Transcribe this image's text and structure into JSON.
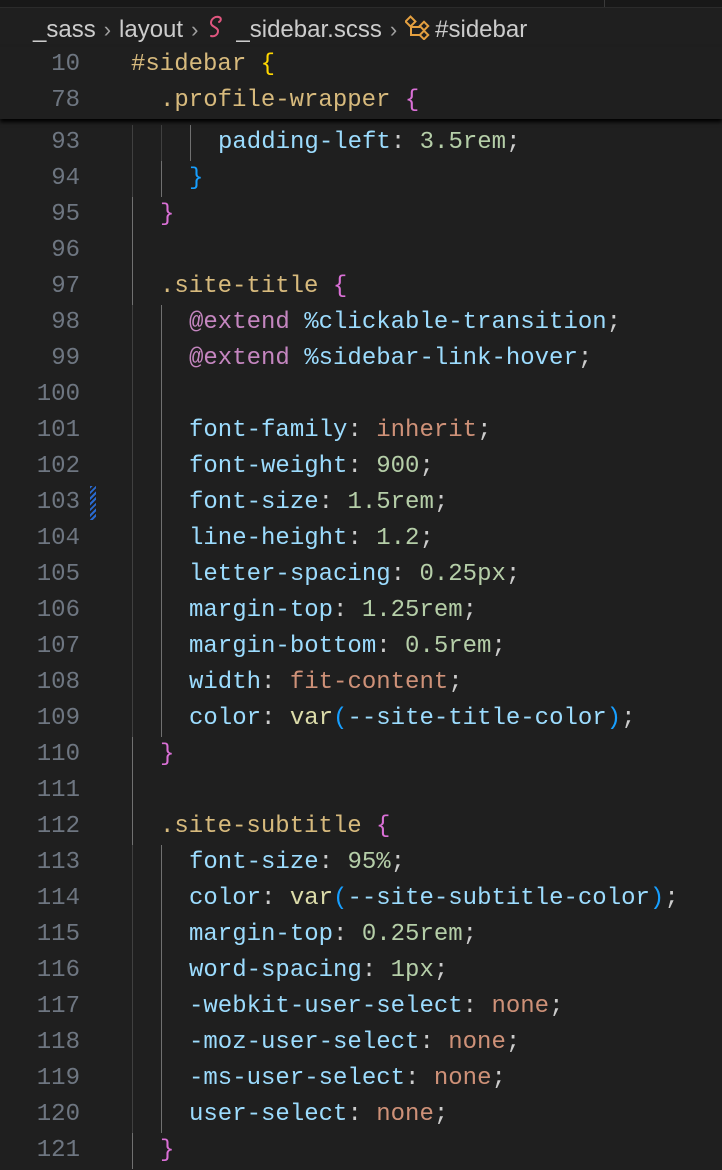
{
  "palette": {
    "sel": "#d7ba7d",
    "prop": "#9cdcfe",
    "num": "#b5cea8",
    "str": "#ce9178",
    "fn": "#dcdcaa",
    "at": "#c586c0",
    "punc": "#cccccc",
    "b1": "#ffd700",
    "b2": "#da70d6",
    "b3": "#179fff"
  },
  "breadcrumb": {
    "items": [
      "_sass",
      "layout",
      "_sidebar.scss",
      "#sidebar"
    ],
    "file_icon": "sass-icon",
    "file_icon_color": "#e0567f",
    "symbol_icon": "symbol-structure-icon",
    "symbol_icon_color": "#e4a040",
    "separator": "›"
  },
  "sticky_scroll": [
    {
      "number": "10",
      "indent": 0,
      "tokens": [
        {
          "t": "#sidebar ",
          "c": "sel"
        },
        {
          "t": "{",
          "c": "b1"
        }
      ]
    },
    {
      "number": "78",
      "indent": 2,
      "tokens": [
        {
          "t": ".profile-wrapper ",
          "c": "sel"
        },
        {
          "t": "{",
          "c": "b2"
        }
      ]
    }
  ],
  "lines": [
    {
      "number": "93",
      "indent": 6,
      "tokens": [
        {
          "t": "padding-left",
          "c": "prop"
        },
        {
          "t": ": ",
          "c": "punc"
        },
        {
          "t": "3.5rem",
          "c": "num"
        },
        {
          "t": ";",
          "c": "punc"
        }
      ]
    },
    {
      "number": "94",
      "indent": 4,
      "tokens": [
        {
          "t": "}",
          "c": "b3"
        }
      ]
    },
    {
      "number": "95",
      "indent": 2,
      "tokens": [
        {
          "t": "}",
          "c": "b2"
        }
      ]
    },
    {
      "number": "96",
      "indent": 2,
      "tokens": []
    },
    {
      "number": "97",
      "indent": 2,
      "tokens": [
        {
          "t": ".site-title ",
          "c": "sel"
        },
        {
          "t": "{",
          "c": "b2"
        }
      ]
    },
    {
      "number": "98",
      "indent": 4,
      "tokens": [
        {
          "t": "@extend ",
          "c": "at"
        },
        {
          "t": "%clickable-transition",
          "c": "prop"
        },
        {
          "t": ";",
          "c": "punc"
        }
      ]
    },
    {
      "number": "99",
      "indent": 4,
      "tokens": [
        {
          "t": "@extend ",
          "c": "at"
        },
        {
          "t": "%sidebar-link-hover",
          "c": "prop"
        },
        {
          "t": ";",
          "c": "punc"
        }
      ]
    },
    {
      "number": "100",
      "indent": 4,
      "tokens": []
    },
    {
      "number": "101",
      "indent": 4,
      "tokens": [
        {
          "t": "font-family",
          "c": "prop"
        },
        {
          "t": ": ",
          "c": "punc"
        },
        {
          "t": "inherit",
          "c": "str"
        },
        {
          "t": ";",
          "c": "punc"
        }
      ]
    },
    {
      "number": "102",
      "indent": 4,
      "tokens": [
        {
          "t": "font-weight",
          "c": "prop"
        },
        {
          "t": ": ",
          "c": "punc"
        },
        {
          "t": "900",
          "c": "num"
        },
        {
          "t": ";",
          "c": "punc"
        }
      ]
    },
    {
      "number": "103",
      "indent": 4,
      "modified": true,
      "tokens": [
        {
          "t": "font-size",
          "c": "prop"
        },
        {
          "t": ": ",
          "c": "punc"
        },
        {
          "t": "1.5rem",
          "c": "num"
        },
        {
          "t": ";",
          "c": "punc"
        }
      ]
    },
    {
      "number": "104",
      "indent": 4,
      "tokens": [
        {
          "t": "line-height",
          "c": "prop"
        },
        {
          "t": ": ",
          "c": "punc"
        },
        {
          "t": "1.2",
          "c": "num"
        },
        {
          "t": ";",
          "c": "punc"
        }
      ]
    },
    {
      "number": "105",
      "indent": 4,
      "tokens": [
        {
          "t": "letter-spacing",
          "c": "prop"
        },
        {
          "t": ": ",
          "c": "punc"
        },
        {
          "t": "0.25px",
          "c": "num"
        },
        {
          "t": ";",
          "c": "punc"
        }
      ]
    },
    {
      "number": "106",
      "indent": 4,
      "tokens": [
        {
          "t": "margin-top",
          "c": "prop"
        },
        {
          "t": ": ",
          "c": "punc"
        },
        {
          "t": "1.25rem",
          "c": "num"
        },
        {
          "t": ";",
          "c": "punc"
        }
      ]
    },
    {
      "number": "107",
      "indent": 4,
      "tokens": [
        {
          "t": "margin-bottom",
          "c": "prop"
        },
        {
          "t": ": ",
          "c": "punc"
        },
        {
          "t": "0.5rem",
          "c": "num"
        },
        {
          "t": ";",
          "c": "punc"
        }
      ]
    },
    {
      "number": "108",
      "indent": 4,
      "tokens": [
        {
          "t": "width",
          "c": "prop"
        },
        {
          "t": ": ",
          "c": "punc"
        },
        {
          "t": "fit-content",
          "c": "str"
        },
        {
          "t": ";",
          "c": "punc"
        }
      ]
    },
    {
      "number": "109",
      "indent": 4,
      "tokens": [
        {
          "t": "color",
          "c": "prop"
        },
        {
          "t": ": ",
          "c": "punc"
        },
        {
          "t": "var",
          "c": "fn"
        },
        {
          "t": "(",
          "c": "b3"
        },
        {
          "t": "--site-title-color",
          "c": "prop"
        },
        {
          "t": ")",
          "c": "b3"
        },
        {
          "t": ";",
          "c": "punc"
        }
      ]
    },
    {
      "number": "110",
      "indent": 2,
      "tokens": [
        {
          "t": "}",
          "c": "b2"
        }
      ]
    },
    {
      "number": "111",
      "indent": 2,
      "tokens": []
    },
    {
      "number": "112",
      "indent": 2,
      "tokens": [
        {
          "t": ".site-subtitle ",
          "c": "sel"
        },
        {
          "t": "{",
          "c": "b2"
        }
      ]
    },
    {
      "number": "113",
      "indent": 4,
      "tokens": [
        {
          "t": "font-size",
          "c": "prop"
        },
        {
          "t": ": ",
          "c": "punc"
        },
        {
          "t": "95%",
          "c": "num"
        },
        {
          "t": ";",
          "c": "punc"
        }
      ]
    },
    {
      "number": "114",
      "indent": 4,
      "tokens": [
        {
          "t": "color",
          "c": "prop"
        },
        {
          "t": ": ",
          "c": "punc"
        },
        {
          "t": "var",
          "c": "fn"
        },
        {
          "t": "(",
          "c": "b3"
        },
        {
          "t": "--site-subtitle-color",
          "c": "prop"
        },
        {
          "t": ")",
          "c": "b3"
        },
        {
          "t": ";",
          "c": "punc"
        }
      ]
    },
    {
      "number": "115",
      "indent": 4,
      "tokens": [
        {
          "t": "margin-top",
          "c": "prop"
        },
        {
          "t": ": ",
          "c": "punc"
        },
        {
          "t": "0.25rem",
          "c": "num"
        },
        {
          "t": ";",
          "c": "punc"
        }
      ]
    },
    {
      "number": "116",
      "indent": 4,
      "tokens": [
        {
          "t": "word-spacing",
          "c": "prop"
        },
        {
          "t": ": ",
          "c": "punc"
        },
        {
          "t": "1px",
          "c": "num"
        },
        {
          "t": ";",
          "c": "punc"
        }
      ]
    },
    {
      "number": "117",
      "indent": 4,
      "tokens": [
        {
          "t": "-webkit-user-select",
          "c": "prop"
        },
        {
          "t": ": ",
          "c": "punc"
        },
        {
          "t": "none",
          "c": "str"
        },
        {
          "t": ";",
          "c": "punc"
        }
      ]
    },
    {
      "number": "118",
      "indent": 4,
      "tokens": [
        {
          "t": "-moz-user-select",
          "c": "prop"
        },
        {
          "t": ": ",
          "c": "punc"
        },
        {
          "t": "none",
          "c": "str"
        },
        {
          "t": ";",
          "c": "punc"
        }
      ]
    },
    {
      "number": "119",
      "indent": 4,
      "tokens": [
        {
          "t": "-ms-user-select",
          "c": "prop"
        },
        {
          "t": ": ",
          "c": "punc"
        },
        {
          "t": "none",
          "c": "str"
        },
        {
          "t": ";",
          "c": "punc"
        }
      ]
    },
    {
      "number": "120",
      "indent": 4,
      "tokens": [
        {
          "t": "user-select",
          "c": "prop"
        },
        {
          "t": ": ",
          "c": "punc"
        },
        {
          "t": "none",
          "c": "str"
        },
        {
          "t": ";",
          "c": "punc"
        }
      ]
    },
    {
      "number": "121",
      "indent": 2,
      "tokens": [
        {
          "t": "}",
          "c": "b2"
        }
      ]
    }
  ]
}
